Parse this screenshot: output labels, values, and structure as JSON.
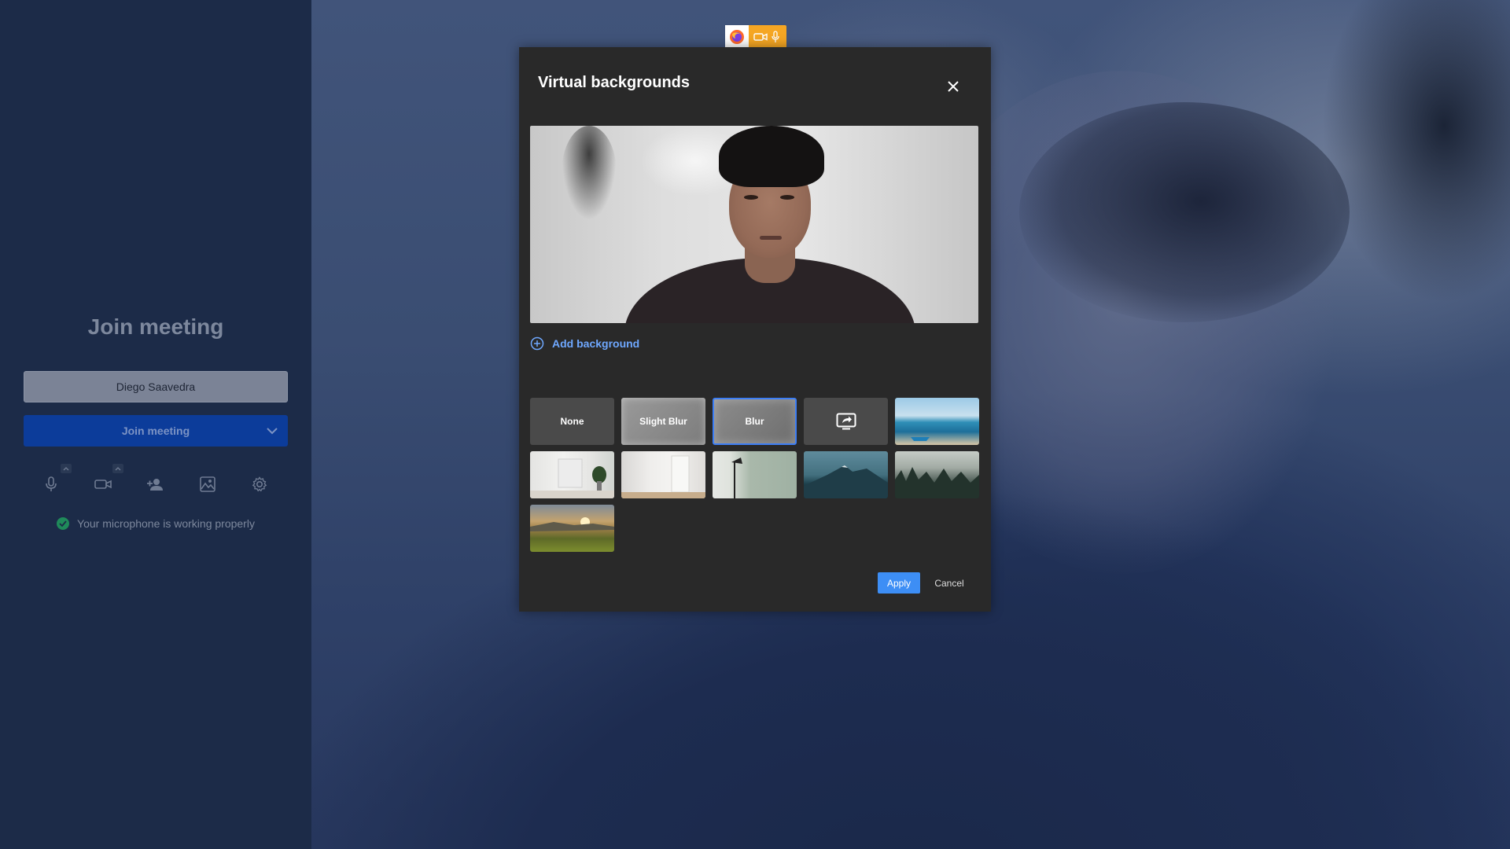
{
  "join_panel": {
    "title": "Join meeting",
    "display_name": "Diego Saavedra",
    "join_button_label": "Join meeting",
    "mic_status": "Your microphone is working properly",
    "toolbar_icons": [
      "microphone-icon",
      "camera-icon",
      "invite-person-icon",
      "background-image-icon",
      "settings-icon"
    ]
  },
  "share_indicator": {
    "icons": [
      "firefox-icon",
      "camera-icon",
      "microphone-icon"
    ],
    "color": "#f5a623"
  },
  "modal": {
    "title": "Virtual backgrounds",
    "add_background_label": "Add background",
    "options": [
      {
        "label": "None",
        "type": "text"
      },
      {
        "label": "Slight Blur",
        "type": "text"
      },
      {
        "label": "Blur",
        "type": "text",
        "selected": true
      },
      {
        "label": "",
        "type": "screen-share-icon"
      },
      {
        "label": "",
        "type": "image",
        "image": "beach"
      },
      {
        "label": "",
        "type": "image",
        "image": "white-room-plant"
      },
      {
        "label": "",
        "type": "image",
        "image": "white-room-door"
      },
      {
        "label": "",
        "type": "image",
        "image": "lamp-green-wall"
      },
      {
        "label": "",
        "type": "image",
        "image": "mountain"
      },
      {
        "label": "",
        "type": "image",
        "image": "misty-forest"
      },
      {
        "label": "",
        "type": "image",
        "image": "sunset-meadow"
      }
    ],
    "apply_label": "Apply",
    "cancel_label": "Cancel"
  },
  "colors": {
    "accent": "#3d8ef5",
    "join_button": "#0c3c9a",
    "modal_bg": "#292929",
    "status_ok": "#1f8a5a"
  }
}
